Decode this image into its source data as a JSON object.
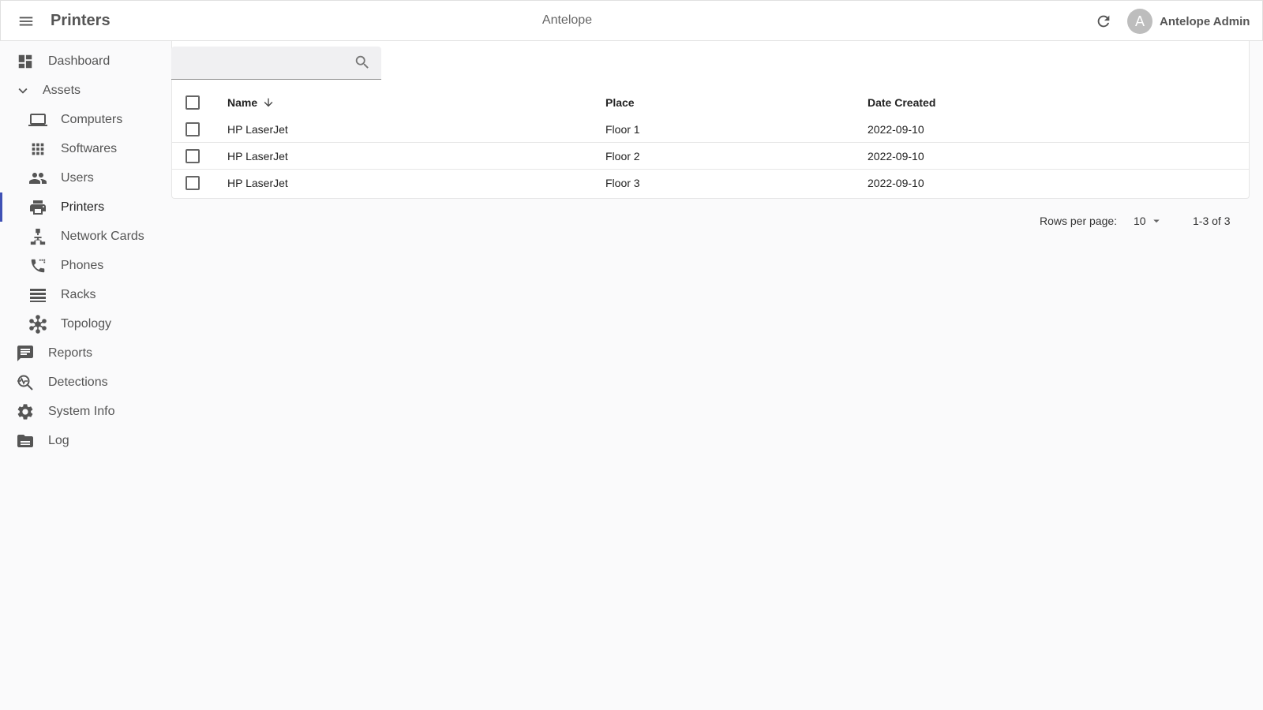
{
  "app": {
    "title": "Printers",
    "brand": "Antelope",
    "user": {
      "initial": "A",
      "name": "Antelope Admin"
    }
  },
  "sidebar": {
    "items": [
      {
        "label": "Dashboard",
        "icon": "dashboard-icon"
      },
      {
        "label": "Assets",
        "icon": "chevron-down-icon"
      },
      {
        "label": "Computers",
        "icon": "laptop-icon"
      },
      {
        "label": "Softwares",
        "icon": "apps-grid-icon"
      },
      {
        "label": "Users",
        "icon": "people-icon"
      },
      {
        "label": "Printers",
        "icon": "printer-icon",
        "active": true
      },
      {
        "label": "Network Cards",
        "icon": "network-icon"
      },
      {
        "label": "Phones",
        "icon": "phone-icon"
      },
      {
        "label": "Racks",
        "icon": "rack-list-icon"
      },
      {
        "label": "Topology",
        "icon": "topology-icon"
      },
      {
        "label": "Reports",
        "icon": "report-chat-icon"
      },
      {
        "label": "Detections",
        "icon": "detection-search-icon"
      },
      {
        "label": "System Info",
        "icon": "gear-icon"
      },
      {
        "label": "Log",
        "icon": "folder-icon"
      }
    ]
  },
  "search": {
    "placeholder": "",
    "value": ""
  },
  "table": {
    "columns": [
      "Name",
      "Place",
      "Date Created"
    ],
    "sort": {
      "column": "Name",
      "direction": "descending-arrow"
    },
    "rows": [
      {
        "name": "HP LaserJet",
        "place": "Floor 1",
        "date": "2022-09-10"
      },
      {
        "name": "HP LaserJet",
        "place": "Floor 2",
        "date": "2022-09-10"
      },
      {
        "name": "HP LaserJet",
        "place": "Floor 3",
        "date": "2022-09-10"
      }
    ]
  },
  "pagination": {
    "rows_per_page_label": "Rows per page:",
    "rows_per_page": "10",
    "range": "1-3 of 3"
  },
  "colors": {
    "active_indicator": "#3f51b5",
    "icon": "#555555",
    "background": "#fafafb"
  }
}
